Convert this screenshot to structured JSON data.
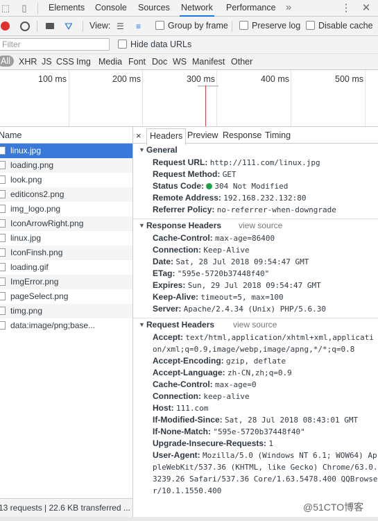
{
  "devtools_tabs": [
    "Elements",
    "Console",
    "Sources",
    "Network",
    "Performance"
  ],
  "overflow_icon": "»",
  "toolbar": {
    "view_label": "View:",
    "group_by_frame": "Group by frame",
    "preserve_log": "Preserve log",
    "disable_cache": "Disable cache"
  },
  "filter": {
    "placeholder": "Filter",
    "hide_data_urls": "Hide data URLs"
  },
  "types": [
    "All",
    "XHR",
    "JS",
    "CSS",
    "Img",
    "Media",
    "Font",
    "Doc",
    "WS",
    "Manifest",
    "Other"
  ],
  "timeline_ticks": [
    "100 ms",
    "200 ms",
    "300 ms",
    "400 ms",
    "500 ms"
  ],
  "list_header": "Name",
  "requests": [
    {
      "name": "linux.jpg",
      "selected": true
    },
    {
      "name": "loading.png"
    },
    {
      "name": "look.png"
    },
    {
      "name": "editicons2.png"
    },
    {
      "name": "img_logo.png"
    },
    {
      "name": "IconArrowRight.png"
    },
    {
      "name": "linux.jpg"
    },
    {
      "name": "IconFinsh.png"
    },
    {
      "name": "loading.gif"
    },
    {
      "name": "ImgError.png"
    },
    {
      "name": "pageSelect.png"
    },
    {
      "name": "timg.png"
    },
    {
      "name": "data:image/png;base..."
    }
  ],
  "status_summary": "13 requests  |  22.6 KB transferred  ...",
  "detail_tabs": [
    "Headers",
    "Preview",
    "Response",
    "Timing"
  ],
  "close_icon": "×",
  "general": {
    "title": "General",
    "request_url_k": "Request URL:",
    "request_url_v": "http://111.com/linux.jpg",
    "request_method_k": "Request Method:",
    "request_method_v": "GET",
    "status_code_k": "Status Code:",
    "status_code_v": "304 Not Modified",
    "remote_address_k": "Remote Address:",
    "remote_address_v": "192.168.232.132:80",
    "referrer_policy_k": "Referrer Policy:",
    "referrer_policy_v": "no-referrer-when-downgrade"
  },
  "response_headers": {
    "title": "Response Headers",
    "view_source": "view source",
    "items": [
      {
        "k": "Cache-Control:",
        "v": "max-age=86400"
      },
      {
        "k": "Connection:",
        "v": "Keep-Alive"
      },
      {
        "k": "Date:",
        "v": "Sat, 28 Jul 2018 09:54:47 GMT"
      },
      {
        "k": "ETag:",
        "v": "\"595e-5720b37448f40\""
      },
      {
        "k": "Expires:",
        "v": "Sun, 29 Jul 2018 09:54:47 GMT"
      },
      {
        "k": "Keep-Alive:",
        "v": "timeout=5, max=100"
      },
      {
        "k": "Server:",
        "v": "Apache/2.4.34 (Unix) PHP/5.6.30"
      }
    ]
  },
  "request_headers": {
    "title": "Request Headers",
    "view_source": "view source",
    "items": [
      {
        "k": "Accept:",
        "v": "text/html,application/xhtml+xml,application/xml;q=0.9,image/webp,image/apng,*/*;q=0.8"
      },
      {
        "k": "Accept-Encoding:",
        "v": "gzip, deflate"
      },
      {
        "k": "Accept-Language:",
        "v": "zh-CN,zh;q=0.9"
      },
      {
        "k": "Cache-Control:",
        "v": "max-age=0"
      },
      {
        "k": "Connection:",
        "v": "keep-alive"
      },
      {
        "k": "Host:",
        "v": "111.com"
      },
      {
        "k": "If-Modified-Since:",
        "v": "Sat, 28 Jul 2018 08:43:01 GMT"
      },
      {
        "k": "If-None-Match:",
        "v": "\"595e-5720b37448f40\""
      },
      {
        "k": "Upgrade-Insecure-Requests:",
        "v": "1"
      },
      {
        "k": "User-Agent:",
        "v": "Mozilla/5.0 (Windows NT 6.1; WOW64) AppleWebKit/537.36 (KHTML, like Gecko) Chrome/63.0.3239.26 Safari/537.36 Core/1.63.5478.400 QQBrowser/10.1.1550.400"
      }
    ]
  },
  "watermark": "@51CTO博客",
  "colors": {
    "accent": "#1a73e8",
    "selected_row": "#3879d9",
    "record_red": "#e0302d",
    "status_green": "#1ea446"
  }
}
